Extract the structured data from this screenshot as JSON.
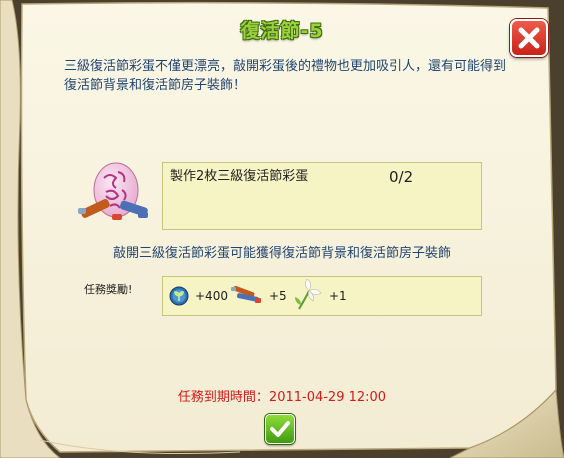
{
  "dialog": {
    "title": "復活節-5",
    "description": "三級復活節彩蛋不僅更漂亮，敲開彩蛋後的禮物也更加吸引人，還有可能得到復活節背景和復活節房子裝飾！"
  },
  "task": {
    "label": "製作2枚三級復活節彩蛋",
    "progress": "0/2"
  },
  "hint": "敲開三級復活節彩蛋可能獲得復活節背景和復活節房子裝飾",
  "rewards": {
    "label": "任務獎勵!",
    "items": [
      {
        "icon": "sprout-coin-icon",
        "value": "+400"
      },
      {
        "icon": "paint-brushes-icon",
        "value": "+5"
      },
      {
        "icon": "lily-flower-icon",
        "value": "+1"
      }
    ]
  },
  "expiry": "任務到期時間：2011-04-29 12:00",
  "colors": {
    "title": "#9bd13a",
    "description": "#1f4470",
    "expiry": "#d41a1a",
    "close_button": "#d63a2c",
    "confirm_button": "#5cb51f",
    "panel_fill": "#f6f3c4"
  }
}
